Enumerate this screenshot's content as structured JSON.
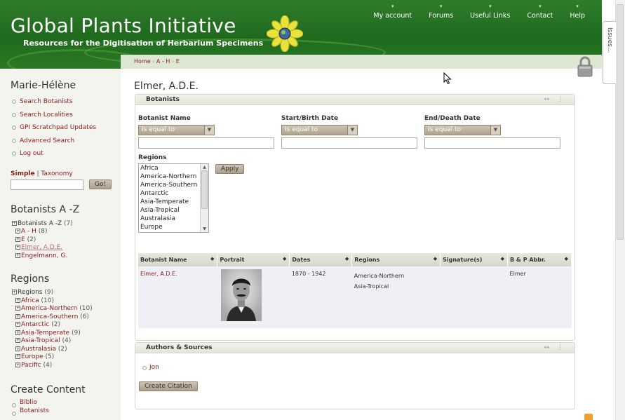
{
  "header": {
    "site_title": "Global Plants Initiative",
    "slogan": "Resources for the Digitisation of Herbarium Specimens",
    "nav": [
      "My account",
      "Forums",
      "Useful Links",
      "Contact",
      "Help"
    ]
  },
  "issues_tab": "Issues...",
  "breadcrumb": [
    "Home",
    "A - H",
    "E"
  ],
  "page_title": "Elmer, A.D.E.",
  "sidebar": {
    "user_block_title": "Marie-Hélène",
    "user_menu": [
      "Search Botanists",
      "Search Localities",
      "GPI Scratchpad Updates",
      "Advanced Search",
      "Log out"
    ],
    "search_tabs": {
      "simple": "Simple",
      "separator": "|",
      "taxonomy": "Taxonomy"
    },
    "search_button": "Go!",
    "botanists_title": "Botanists A -Z",
    "botanists_tree": [
      {
        "label": "Botanists A -Z",
        "count": "(7)"
      },
      {
        "label": "A - H",
        "count": "(8)"
      },
      {
        "label": "E",
        "count": "(2)"
      },
      {
        "label": "Elmer, A.D.E.",
        "count": ""
      },
      {
        "label": "Engelmann, G.",
        "count": ""
      }
    ],
    "regions_title": "Regions",
    "regions_tree": [
      {
        "label": "Regions",
        "count": "(9)"
      },
      {
        "label": "Africa",
        "count": "(10)"
      },
      {
        "label": "America-Northern",
        "count": "(10)"
      },
      {
        "label": "America-Southern",
        "count": "(6)"
      },
      {
        "label": "Antarctic",
        "count": "(2)"
      },
      {
        "label": "Asia-Temperate",
        "count": "(9)"
      },
      {
        "label": "Asia-Tropical",
        "count": "(4)"
      },
      {
        "label": "Australasia",
        "count": "(2)"
      },
      {
        "label": "Europe",
        "count": "(5)"
      },
      {
        "label": "Pacific",
        "count": "(4)"
      }
    ],
    "create_title": "Create Content",
    "create_menu": [
      "Biblio",
      "Botanists"
    ]
  },
  "botanists_panel": {
    "title": "Botanists",
    "tools": "↔ ⋮",
    "filters": {
      "name_label": "Botanist Name",
      "start_label": "Start/Birth Date",
      "end_label": "End/Death Date",
      "operator": "Is equal to",
      "regions_label": "Regions",
      "apply_button": "Apply",
      "region_options": [
        "Africa",
        "America-Northern",
        "America-Southern",
        "Antarctic",
        "Asia-Temperate",
        "Asia-Tropical",
        "Australasia",
        "Europe"
      ]
    },
    "table": {
      "headers": [
        "Botanist Name",
        "Portrait",
        "Dates",
        "Regions",
        "Signature(s)",
        "B & P Abbr."
      ],
      "row": {
        "name": "Elmer, A.D.E.",
        "dates": "1870 - 1942",
        "regions": [
          "America-Northern",
          "Asia-Tropical"
        ],
        "signature": "",
        "abbr": "Elmer"
      }
    }
  },
  "authors_panel": {
    "title": "Authors & Sources",
    "tools": "↔ ⋮",
    "items": [
      "Jon"
    ],
    "button": "Create Citation"
  },
  "colors": {
    "header_green": "#1f6a1e",
    "link_red": "#8b1a1a",
    "sidebar_bg": "#f4f4ef",
    "button_tan": "#b0a48f"
  }
}
